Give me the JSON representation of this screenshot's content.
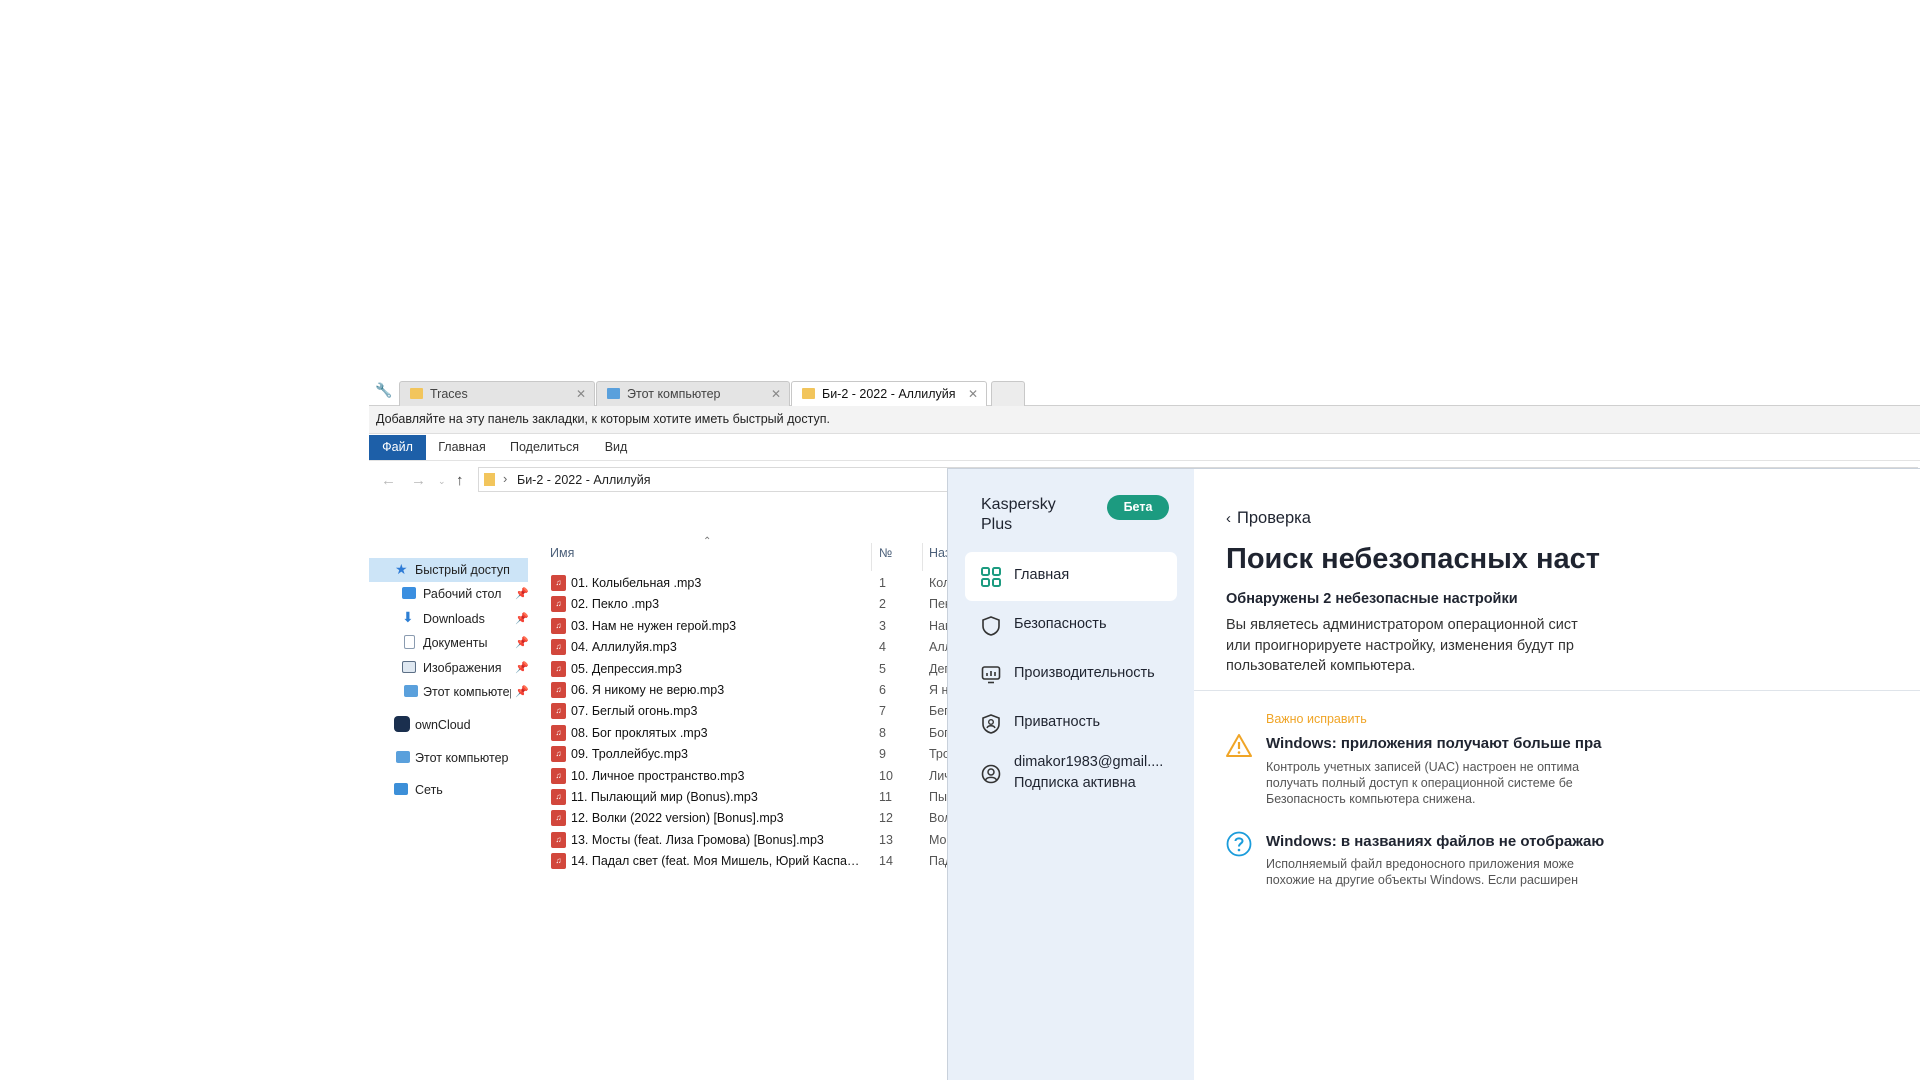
{
  "tabs": [
    {
      "label": "Traces",
      "icon": "folder-icon"
    },
    {
      "label": "Этот компьютер",
      "icon": "computer-icon"
    },
    {
      "label": "Би-2 - 2022 - Аллилуйя",
      "icon": "folder-icon"
    }
  ],
  "bookmarks_bar_text": "Добавляйте на эту панель закладки, к которым хотите иметь быстрый доступ.",
  "ribbon": {
    "file": "Файл",
    "home": "Главная",
    "share": "Поделиться",
    "view": "Вид"
  },
  "address": {
    "path": "Би-2 - 2022 - Аллилуйя",
    "separator": "›"
  },
  "nav_pane": {
    "quick_access": "Быстрый доступ",
    "items": [
      "Рабочий стол",
      "Downloads",
      "Документы",
      "Изображения",
      "Этот компьютер"
    ],
    "owncloud": "ownCloud",
    "this_pc": "Этот компьютер",
    "network": "Сеть"
  },
  "columns": {
    "name": "Имя",
    "number": "№",
    "title": "Наз"
  },
  "files": [
    {
      "name": "01. Колыбельная .mp3",
      "num": "1",
      "title": "Кол"
    },
    {
      "name": "02. Пекло .mp3",
      "num": "2",
      "title": "Пек"
    },
    {
      "name": "03. Нам не нужен герой.mp3",
      "num": "3",
      "title": "Нам"
    },
    {
      "name": "04. Аллилуйя.mp3",
      "num": "4",
      "title": "Алл"
    },
    {
      "name": "05. Депрессия.mp3",
      "num": "5",
      "title": "Деп"
    },
    {
      "name": "06. Я никому не верю.mp3",
      "num": "6",
      "title": "Я н"
    },
    {
      "name": "07. Беглый огонь.mp3",
      "num": "7",
      "title": "Бег"
    },
    {
      "name": "08. Бог проклятых .mp3",
      "num": "8",
      "title": "Бог"
    },
    {
      "name": "09. Троллейбус.mp3",
      "num": "9",
      "title": "Тро"
    },
    {
      "name": "10. Личное пространство.mp3",
      "num": "10",
      "title": "Лич"
    },
    {
      "name": "11. Пылающий мир (Bonus).mp3",
      "num": "11",
      "title": "Пы"
    },
    {
      "name": "12. Волки (2022 version) [Bonus].mp3",
      "num": "12",
      "title": "Вол"
    },
    {
      "name": "13. Мосты (feat. Лиза Громова) [Bonus].mp3",
      "num": "13",
      "title": "Мо"
    },
    {
      "name": "14. Падал свет (feat. Моя Мишель, Юрий Каспаря...",
      "num": "14",
      "title": "Пад"
    }
  ],
  "kaspersky": {
    "brand": "Kaspersky Plus",
    "beta": "Бета",
    "menu": [
      "Главная",
      "Безопасность",
      "Производительность",
      "Приватность"
    ],
    "account_email": "dimakor1983@gmail....",
    "account_status": "Подписка активна",
    "back": "Проверка",
    "title": "Поиск небезопасных наст",
    "subtitle": "Обнаружены 2 небезопасные настройки",
    "description": [
      "Вы являетесь администратором операционной сист",
      "или проигнорируете настройку, изменения будут пр",
      "пользователей компьютера."
    ],
    "warning_label": "Важно исправить",
    "issues": [
      {
        "title": "Windows: приложения получают больше пра",
        "desc": [
          "Контроль учетных записей (UAC) настроен не оптима",
          "получать полный доступ к операционной системе бе",
          "Безопасность компьютера снижена."
        ],
        "icon": "warning-icon"
      },
      {
        "title": "Windows: в названиях файлов не отображаю",
        "desc": [
          "Исполняемый файл вредоносного приложения може",
          "похожие на другие объекты Windows. Если расширен"
        ],
        "icon": "question-icon"
      }
    ],
    "accent": "#1c9b80",
    "warning_color": "#f0a527",
    "info_color": "#1b9cdb"
  }
}
